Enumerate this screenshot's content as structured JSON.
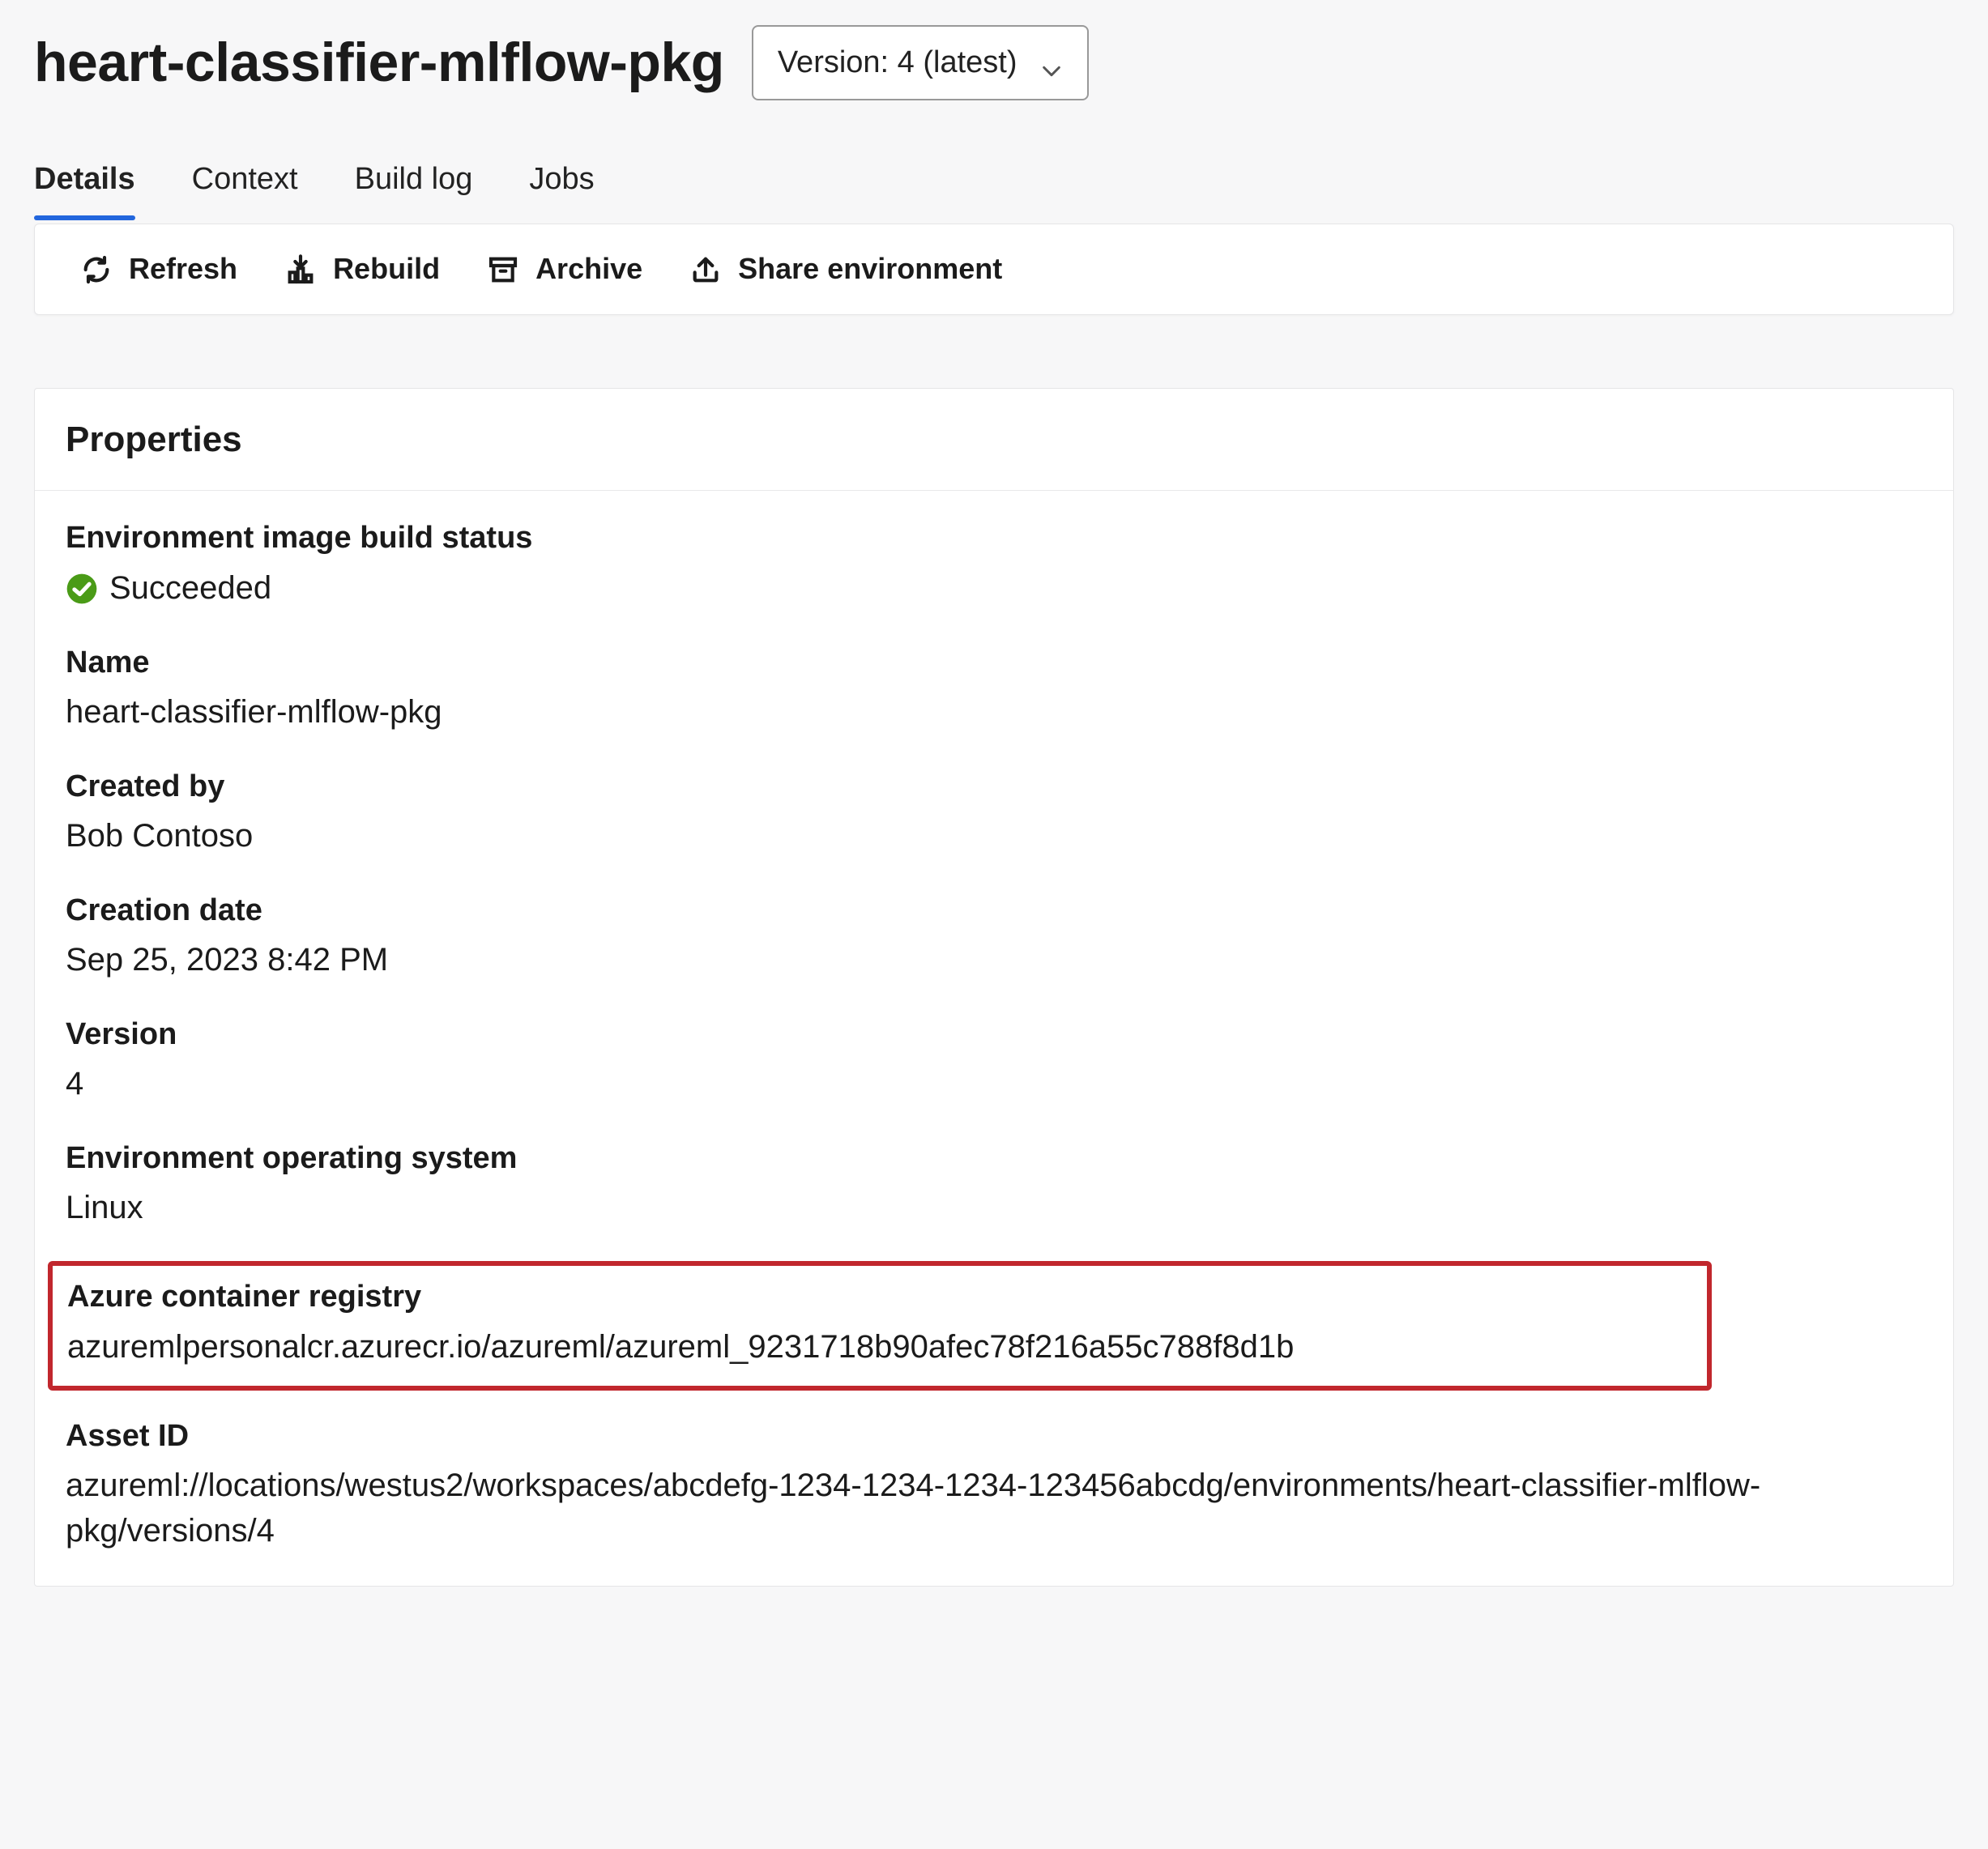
{
  "header": {
    "title": "heart-classifier-mlflow-pkg",
    "version_selector_label": "Version: 4 (latest)"
  },
  "tabs": [
    {
      "label": "Details",
      "active": true
    },
    {
      "label": "Context",
      "active": false
    },
    {
      "label": "Build log",
      "active": false
    },
    {
      "label": "Jobs",
      "active": false
    }
  ],
  "toolbar": {
    "refresh": "Refresh",
    "rebuild": "Rebuild",
    "archive": "Archive",
    "share_env": "Share environment"
  },
  "panel": {
    "title": "Properties",
    "props": {
      "build_status_label": "Environment image build status",
      "build_status_value": "Succeeded",
      "name_label": "Name",
      "name_value": "heart-classifier-mlflow-pkg",
      "created_by_label": "Created by",
      "created_by_value": "Bob Contoso",
      "creation_date_label": "Creation date",
      "creation_date_value": "Sep 25, 2023 8:42 PM",
      "version_label": "Version",
      "version_value": "4",
      "os_label": "Environment operating system",
      "os_value": "Linux",
      "acr_label": "Azure container registry",
      "acr_value": "azuremlpersonalcr.azurecr.io/azureml/azureml_9231718b90afec78f216a55c788f8d1b",
      "asset_id_label": "Asset ID",
      "asset_id_value": "azureml://locations/westus2/workspaces/abcdefg-1234-1234-1234-123456abcdg/environments/heart-classifier-mlflow-pkg/versions/4"
    }
  }
}
